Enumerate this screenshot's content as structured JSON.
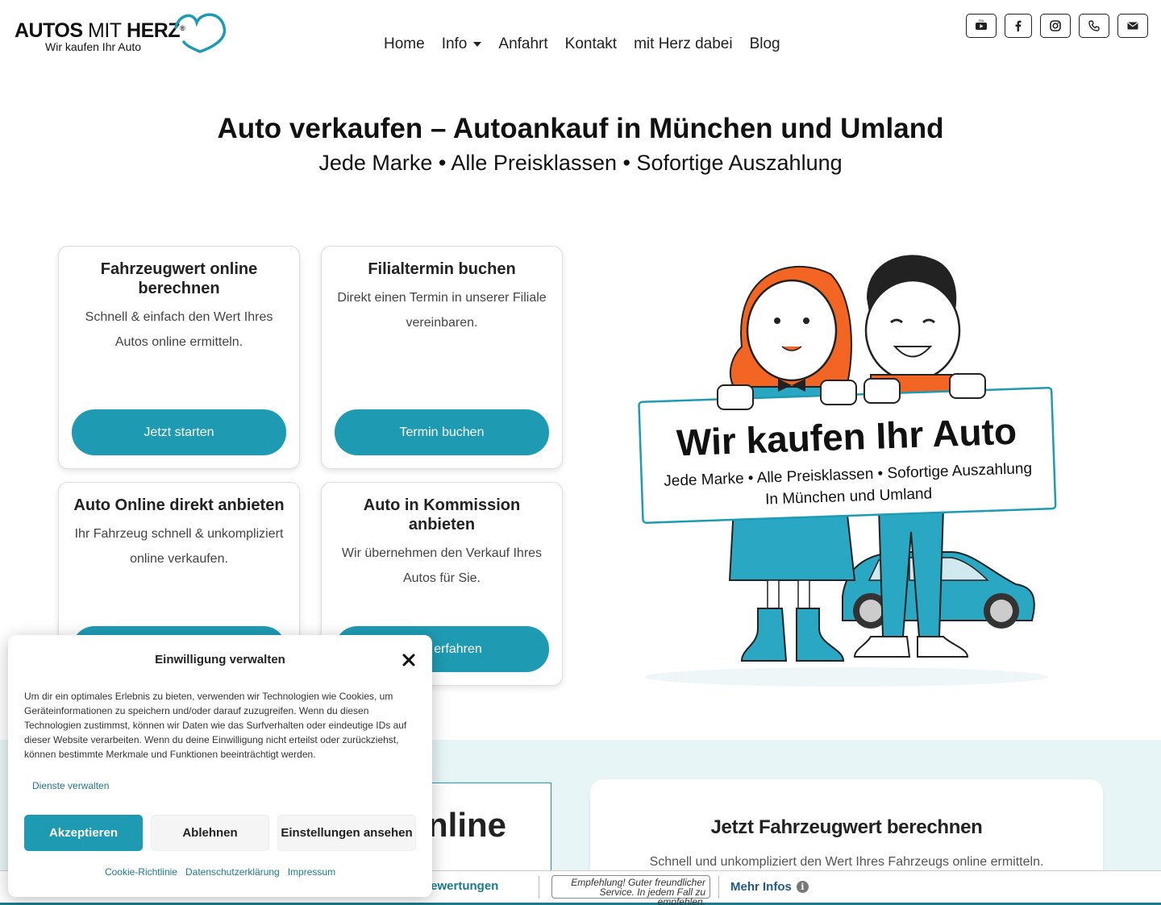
{
  "header": {
    "logo_main_bold": "AUTOS",
    "logo_main_light": "MIT",
    "logo_main_bold2": "HERZ",
    "logo_reg": "®",
    "logo_sub": "Wir kaufen Ihr Auto",
    "nav": [
      {
        "label": "Home"
      },
      {
        "label": "Info"
      },
      {
        "label": "Anfahrt"
      },
      {
        "label": "Kontakt"
      },
      {
        "label": "mit Herz dabei"
      },
      {
        "label": "Blog"
      }
    ],
    "social_icons": [
      "youtube-icon",
      "facebook-icon",
      "instagram-icon",
      "phone-icon",
      "envelope-icon"
    ]
  },
  "hero": {
    "title_bold": "Auto verkaufen – Autoankauf",
    "title_rest": " in München und Umland",
    "subtitle": "Jede Marke • Alle Preisklassen • Sofortige Auszahlung"
  },
  "cards": [
    {
      "title": "Fahrzeugwert online berechnen",
      "text": "Schnell & einfach den Wert Ihres Autos online ermitteln.",
      "button": "Jetzt starten"
    },
    {
      "title": "Filialtermin buchen",
      "text": "Direkt einen Termin in unserer Filiale vereinbaren.",
      "button": "Termin buchen"
    },
    {
      "title": "Auto Online direkt anbieten",
      "text": "Ihr Fahrzeug schnell & unkompliziert online verkaufen.",
      "button": ""
    },
    {
      "title": "Auto in Kommission anbieten",
      "text": "Wir übernehmen den Verkauf Ihres Autos für Sie.",
      "button": "erfahren"
    }
  ],
  "illustration": {
    "sign_title": "Wir kaufen Ihr Auto",
    "sign_line1": "Jede Marke • Alle Preisklassen • Sofortige Auszahlung",
    "sign_line2": "In München und Umland"
  },
  "lower": {
    "online_word": "nline",
    "calc_title": "Jetzt Fahrzeugwert berechnen",
    "calc_text": "Schnell und unkompliziert den Wert Ihres Fahrzeugs online ermitteln."
  },
  "trustbar": {
    "reviews": "undenbewertungen",
    "quote_line1": "Empfehlung! Guter freundlicher",
    "quote_line2": "Service. In jedem Fall zu empfehlen.",
    "more": "Mehr Infos"
  },
  "consent": {
    "title": "Einwilligung verwalten",
    "body": "Um dir ein optimales Erlebnis zu bieten, verwenden wir Technologien wie Cookies, um Geräteinformationen zu speichern und/oder darauf zuzugreifen. Wenn du diesen Technologien zustimmst, können wir Daten wie das Surfverhalten oder eindeutige IDs auf dieser Website verarbeiten. Wenn du deine Einwilligung nicht erteilst oder zurückziehst, können bestimmte Merkmale und Funktionen beeinträchtigt werden.",
    "manage": "Dienste verwalten",
    "accept": "Akzeptieren",
    "deny": "Ablehnen",
    "settings": "Einstellungen ansehen",
    "links": [
      "Cookie-Richtlinie",
      "Datenschutzerklärung",
      "Impressum"
    ]
  },
  "colors": {
    "accent": "#1e9bb3",
    "lower_bg": "#e8f5f7",
    "hair_orange": "#f26522",
    "dark_teal": "#1e7a8a"
  }
}
